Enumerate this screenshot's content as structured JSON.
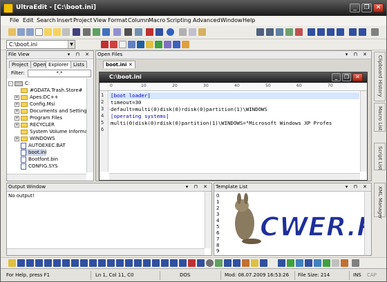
{
  "app": {
    "title": "UltraEdit - [C:\\boot.ini]",
    "window_controls": [
      "_",
      "❐",
      "✕"
    ]
  },
  "menu": [
    "File",
    "Edit",
    "Search",
    "Insert",
    "Project",
    "View",
    "Format",
    "Column",
    "Macro",
    "Scripting",
    "Advanced",
    "Window",
    "Help"
  ],
  "toolbar2": {
    "combo_value": "C:\\boot.ini"
  },
  "file_view": {
    "title": "File View",
    "tabs": [
      "Project",
      "Open",
      "Explorer",
      "Lists"
    ],
    "active_tab": "Explorer",
    "filter_label": "Filter:",
    "filter_value": "*.*",
    "tree": [
      {
        "label": "C:",
        "kind": "drive",
        "expander": "-"
      },
      {
        "label": "#GDATA.Trash.Store#",
        "kind": "folder",
        "expander": ""
      },
      {
        "label": "Apes:DC++",
        "kind": "folder",
        "expander": "+"
      },
      {
        "label": "Config.Msi",
        "kind": "folder",
        "expander": "+"
      },
      {
        "label": "Documents and Setting",
        "kind": "folder",
        "expander": "+"
      },
      {
        "label": "Program Files",
        "kind": "folder",
        "expander": "+"
      },
      {
        "label": "RECYCLER",
        "kind": "folder",
        "expander": "+"
      },
      {
        "label": "System Volume Informa",
        "kind": "folder",
        "expander": ""
      },
      {
        "label": "WINDOWS",
        "kind": "folder",
        "expander": "+"
      },
      {
        "label": "AUTOEXEC.BAT",
        "kind": "file",
        "expander": ""
      },
      {
        "label": "boot.ini",
        "kind": "file",
        "expander": ""
      },
      {
        "label": "Bootfont.bin",
        "kind": "file",
        "expander": ""
      },
      {
        "label": "CONFIG.SYS",
        "kind": "file",
        "expander": ""
      }
    ]
  },
  "open_files": {
    "title": "Open Files",
    "tab_label": "boot.ini"
  },
  "editor": {
    "title": "C:\\boot.ini",
    "ruler_marks": [
      "0",
      "10",
      "20",
      "30",
      "40",
      "50",
      "60",
      "70"
    ],
    "lines": [
      {
        "n": "1",
        "text": "[boot loader]",
        "section": true
      },
      {
        "n": "2",
        "text": "timeout=30",
        "section": false
      },
      {
        "n": "3",
        "text": "default=multi(0)disk(0)rdisk(0)partition(1)\\WINDOWS",
        "section": false
      },
      {
        "n": "4",
        "text": "[operating systems]",
        "section": true
      },
      {
        "n": "5",
        "text": "multi(0)disk(0)rdisk(0)partition(1)\\WINDOWS=\"Microsoft Windows XP Profes",
        "section": false
      },
      {
        "n": "6",
        "text": "",
        "section": false
      }
    ]
  },
  "output_window": {
    "title": "Output Window",
    "text": "No output!"
  },
  "template_list": {
    "title": "Template List",
    "numbers": [
      "0",
      "1",
      "2",
      "3",
      "4",
      "5",
      "6",
      "7",
      "8",
      "9"
    ],
    "logo_text": "CWER.RU"
  },
  "side_tabs": [
    "Clipboard History",
    "Macro List",
    "Script List",
    "XML Manager"
  ],
  "status": {
    "help": "For Help, press F1",
    "position": "Ln 1, Col 11, C0",
    "line_ending": "DOS",
    "modified": "Mod: 08.07.2009 16:53:26",
    "file_size": "File Size: 214",
    "ins": "INS",
    "caps": "CAP"
  },
  "colors": {
    "titlebar": "#1a1a1a",
    "section_text": "#0000c0",
    "highlight_line": "#d6e6ff",
    "logo_blue": "#1e2f9a"
  }
}
